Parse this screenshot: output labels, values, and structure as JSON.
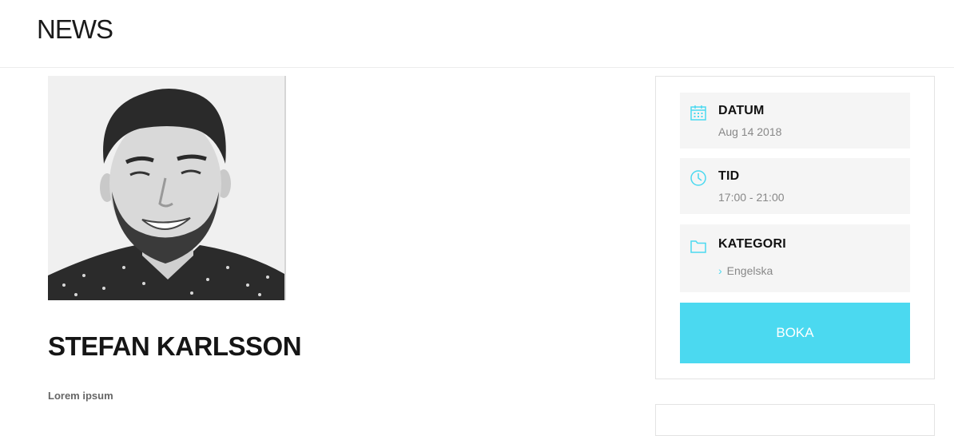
{
  "header": {
    "title": "NEWS"
  },
  "main": {
    "person_name": "STEFAN KARLSSON",
    "intro": "Lorem ipsum"
  },
  "sidebar": {
    "accent_color": "#4bd9f0",
    "datum": {
      "label": "DATUM",
      "value": "Aug 14 2018",
      "icon": "calendar-icon"
    },
    "tid": {
      "label": "TID",
      "value": "17:00 - 21:00",
      "icon": "clock-icon"
    },
    "kategori": {
      "label": "KATEGORI",
      "items": [
        "Engelska"
      ],
      "icon": "folder-icon"
    },
    "boka_label": "BOKA"
  }
}
